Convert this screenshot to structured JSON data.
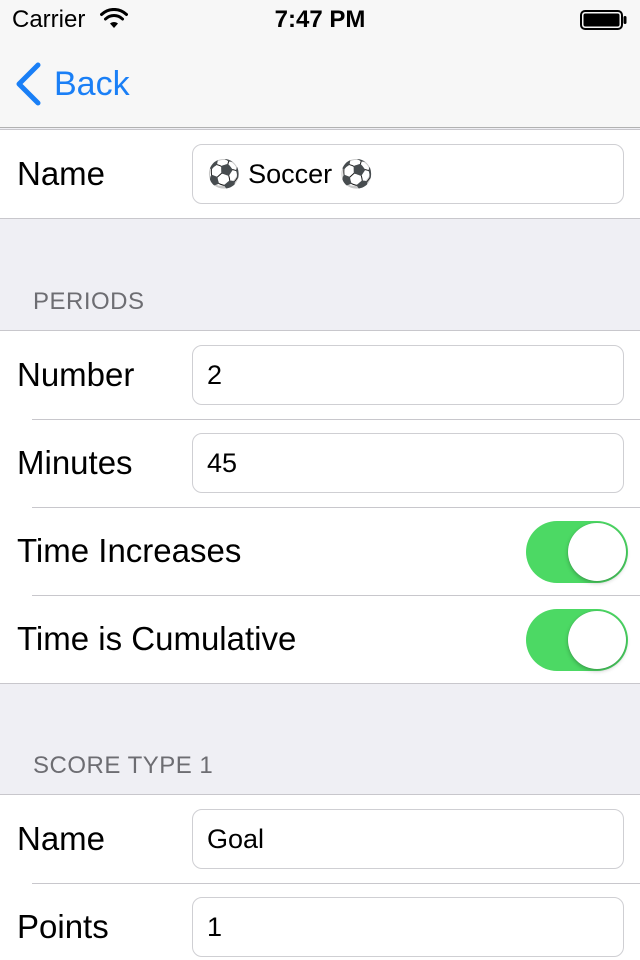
{
  "status_bar": {
    "carrier": "Carrier",
    "time": "7:47 PM"
  },
  "nav": {
    "back_label": "Back"
  },
  "sections": {
    "general": {
      "name_label": "Name",
      "name_value": "⚽ Soccer ⚽"
    },
    "periods": {
      "header": "PERIODS",
      "number_label": "Number",
      "number_value": "2",
      "minutes_label": "Minutes",
      "minutes_value": "45",
      "time_increases_label": "Time Increases",
      "time_increases_on": true,
      "time_cumulative_label": "Time is Cumulative",
      "time_cumulative_on": true
    },
    "score_type_1": {
      "header": "SCORE TYPE 1",
      "name_label": "Name",
      "name_value": "Goal",
      "points_label": "Points",
      "points_value": "1"
    }
  },
  "colors": {
    "accent": "#1a7ff6",
    "toggle_on": "#4cd964",
    "group_background": "#efeff4"
  }
}
